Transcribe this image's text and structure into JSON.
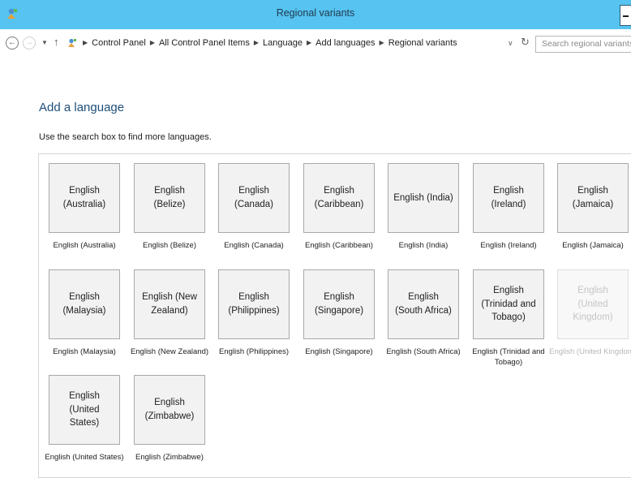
{
  "window": {
    "title": "Regional variants",
    "app_icon": "control-panel-icon",
    "accent": "#56c3f0"
  },
  "navbar": {
    "breadcrumb": [
      "Control Panel",
      "All Control Panel Items",
      "Language",
      "Add languages",
      "Regional variants"
    ],
    "search_placeholder": "Search regional variants"
  },
  "main": {
    "heading": "Add a language",
    "instructions": "Use the search box to find more languages."
  },
  "tiles": [
    {
      "label": "English (Australia)",
      "caption": "English (Australia)",
      "enabled": true
    },
    {
      "label": "English (Belize)",
      "caption": "English (Belize)",
      "enabled": true
    },
    {
      "label": "English (Canada)",
      "caption": "English (Canada)",
      "enabled": true
    },
    {
      "label": "English (Caribbean)",
      "caption": "English (Caribbean)",
      "enabled": true
    },
    {
      "label": "English (India)",
      "caption": "English (India)",
      "enabled": true
    },
    {
      "label": "English (Ireland)",
      "caption": "English (Ireland)",
      "enabled": true
    },
    {
      "label": "English (Jamaica)",
      "caption": "English (Jamaica)",
      "enabled": true
    },
    {
      "label": "English (Malaysia)",
      "caption": "English (Malaysia)",
      "enabled": true
    },
    {
      "label": "English (New Zealand)",
      "caption": "English (New Zealand)",
      "enabled": true
    },
    {
      "label": "English (Philippines)",
      "caption": "English (Philippines)",
      "enabled": true
    },
    {
      "label": "English (Singapore)",
      "caption": "English (Singapore)",
      "enabled": true
    },
    {
      "label": "English (South Africa)",
      "caption": "English (South Africa)",
      "enabled": true
    },
    {
      "label": "English (Trinidad and Tobago)",
      "caption": "English (Trinidad and Tobago)",
      "enabled": true
    },
    {
      "label": "English (United Kingdom)",
      "caption": "English (United Kingdom)",
      "enabled": false
    },
    {
      "label": "English (United States)",
      "caption": "English (United States)",
      "enabled": true
    },
    {
      "label": "English (Zimbabwe)",
      "caption": "English (Zimbabwe)",
      "enabled": true
    }
  ]
}
